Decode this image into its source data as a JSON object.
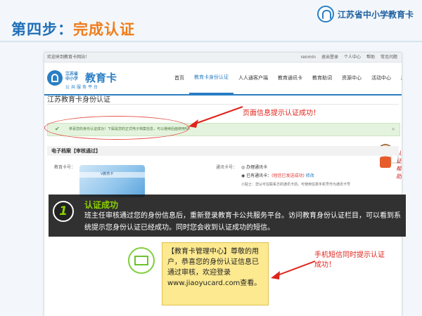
{
  "slide": {
    "title_prefix": "第四步：",
    "title_highlight": "完成认证",
    "brand": "江苏省中小学教育卡"
  },
  "site": {
    "welcome": "欢迎来到教育卡网站！",
    "top_links": [
      "renmin",
      "退出登录",
      "个人中心",
      "帮助",
      "常见问题"
    ],
    "logo_small_1": "江苏省",
    "logo_small_2": "中小学",
    "logo_big": "教育卡",
    "logo_sub": "公共服务平台",
    "nav": [
      "首页",
      "教育卡身份认证",
      "人人通客户端",
      "教育通讯卡",
      "教育助词",
      "资源中心",
      "活动中心",
      "应用中心"
    ],
    "page_heading": "江苏教育卡身份认证",
    "success_msg": "恭喜您的身份认证成功！下属是您的正式电子档案信息，可以继续后面使用吗！",
    "close": "×",
    "info_head": "电子档案【审核通过】",
    "card_label": "教育卡号：",
    "card_img_text": "V教育卡",
    "phone_label": "通讯卡号：",
    "radio1": "◎ 办理通讯卡",
    "radio2_prefix": "◉ 已有通讯卡：",
    "radio2_red": "(短信已发送成功)",
    "radio2_link": "修改",
    "small_note": "小贴士：您认可在联系方的通讯卡前，可使用任意手机号作为通讯卡号"
  },
  "callouts": {
    "page_success": "页面信息提示认证成功！",
    "badge": "认证帮助",
    "sms_success": "手机短信同时提示认证成功！"
  },
  "step": {
    "number": "1",
    "title": "认证成功",
    "text": "班主任审核通过您的身份信息后，重新登录教育卡公共服务平台。访问教育身份认证栏目，可以看到系统提示您身份认证已经成功。同时您会收到认证成功的短信。"
  },
  "sms": {
    "text": "【教育卡管理中心】尊敬的用户，恭喜您的身份认证信息已通过审核，欢迎登录www.jiaoyucard.com查看。"
  },
  "colors": {
    "title_blue": "#1f6fb8",
    "title_orange": "#f07c1a",
    "callout_red": "#e0231b",
    "band_green": "#8bd100",
    "sms_yellow": "#fde98f"
  }
}
